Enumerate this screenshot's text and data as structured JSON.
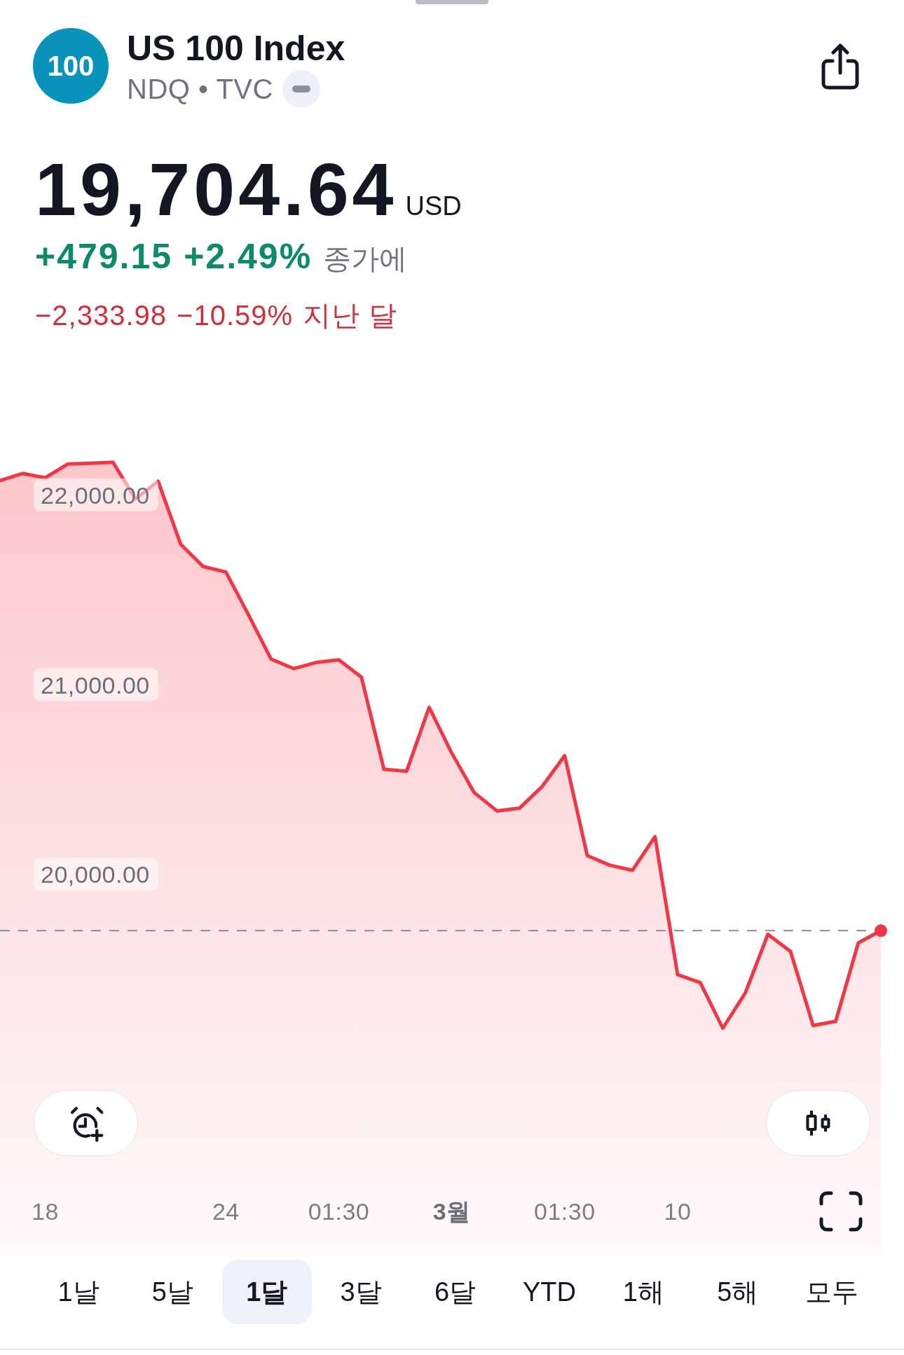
{
  "header": {
    "logo_text": "100",
    "title": "US 100 Index",
    "subtitle": "NDQ • TVC"
  },
  "quote": {
    "price": "19,704.64",
    "currency": "USD",
    "change": "+479.15",
    "change_percent": "+2.49%",
    "label": "종가에",
    "positive": true
  },
  "period_change": {
    "change": "−2,333.98",
    "change_percent": "−10.59%",
    "label": "지난 달",
    "positive": false
  },
  "chart": {
    "chart_data": {
      "type": "area",
      "categories": [
        null,
        null,
        "18",
        null,
        null,
        null,
        null,
        null,
        null,
        null,
        "24",
        null,
        null,
        null,
        null,
        "01:30",
        null,
        null,
        null,
        null,
        "3월",
        null,
        null,
        null,
        null,
        "01:30",
        null,
        null,
        null,
        null,
        "10",
        null,
        null,
        null,
        null,
        null,
        null,
        null,
        null,
        null
      ],
      "values": [
        22077,
        22114,
        22091,
        22164,
        22168,
        22173,
        21980,
        22073,
        21741,
        21623,
        21595,
        21370,
        21136,
        21086,
        21118,
        21132,
        21041,
        20555,
        20545,
        20882,
        20641,
        20432,
        20336,
        20350,
        20464,
        20627,
        20100,
        20050,
        20023,
        20200,
        19473,
        19432,
        19191,
        19377,
        19686,
        19595,
        19205,
        19227,
        19641,
        19705
      ],
      "ylim": [
        17480,
        24609
      ],
      "yticks": [
        {
          "value": 20000,
          "label": "20,000.00"
        },
        {
          "value": 21000,
          "label": "21,000.00"
        },
        {
          "value": 22000,
          "label": "22,000.00"
        }
      ],
      "ref_lines": [
        {
          "axis": "y",
          "value": 19705
        }
      ]
    },
    "x_label_month_start": [
      false,
      false,
      false,
      true,
      false,
      false
    ]
  },
  "ranges": [
    {
      "label": "1날",
      "selected": false
    },
    {
      "label": "5날",
      "selected": false
    },
    {
      "label": "1달",
      "selected": true
    },
    {
      "label": "3달",
      "selected": false
    },
    {
      "label": "6달",
      "selected": false
    },
    {
      "label": "YTD",
      "selected": false
    },
    {
      "label": "1해",
      "selected": false
    },
    {
      "label": "5해",
      "selected": false
    },
    {
      "label": "모두",
      "selected": false
    }
  ]
}
